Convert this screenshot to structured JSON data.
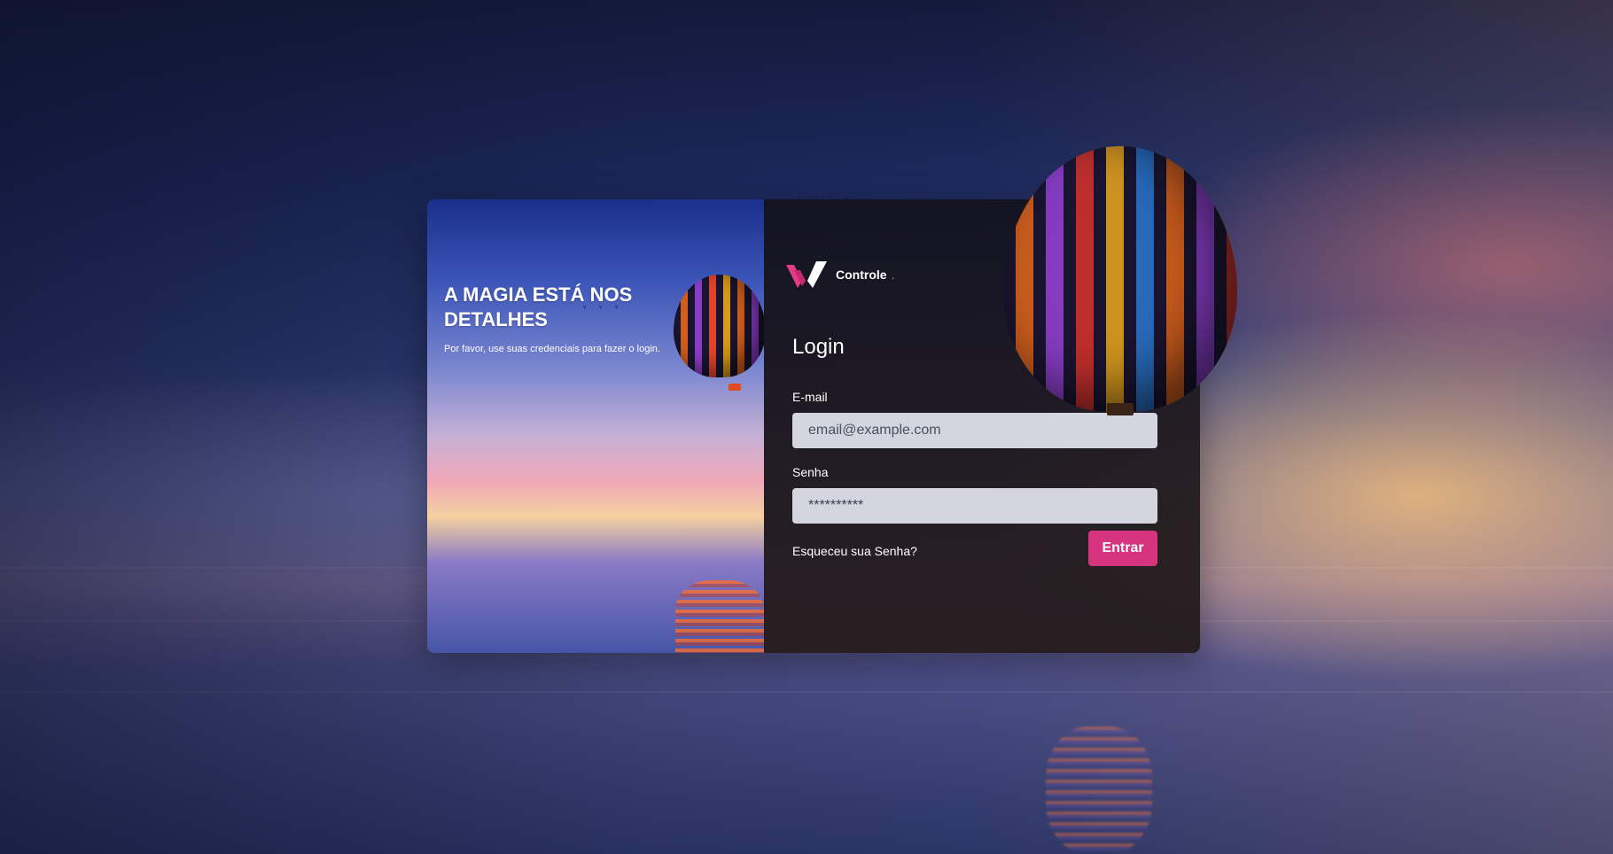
{
  "hero": {
    "title": "A MAGIA ESTÁ NOS DETALHES",
    "subtitle": "Por favor, use suas credenciais para fazer o login."
  },
  "brand": {
    "name": "Controle",
    "suffix": "."
  },
  "form": {
    "title": "Login",
    "email_label": "E-mail",
    "email_placeholder": "email@example.com",
    "email_value": "",
    "password_label": "Senha",
    "password_value": "**********",
    "forgot_label": "Esqueceu sua Senha?",
    "submit_label": "Entrar"
  },
  "icons": {
    "logo": "brand-logo-icon"
  },
  "colors": {
    "accent": "#d6347e",
    "input_bg": "#d3d5df",
    "panel_bg": "#1c1820",
    "text": "#ffffff"
  }
}
